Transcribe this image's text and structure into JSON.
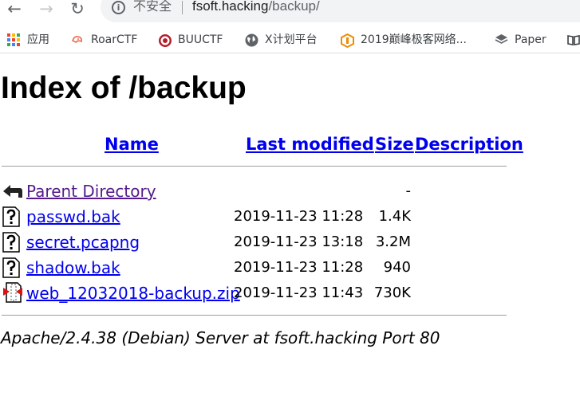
{
  "browser": {
    "security_label": "不安全",
    "url_host": "fsoft.hacking",
    "url_path": "/backup/"
  },
  "bookmarks": [
    {
      "label": "应用",
      "icon": "apps-grid-icon"
    },
    {
      "label": "RoarCTF",
      "icon": "roarctf-icon"
    },
    {
      "label": "BUUCTF",
      "icon": "buuctf-icon"
    },
    {
      "label": "X计划平台",
      "icon": "globe-icon"
    },
    {
      "label": "2019巅峰极客网络...",
      "icon": "hexagon-logo-icon"
    },
    {
      "label": "Paper",
      "icon": "layers-icon"
    }
  ],
  "page": {
    "title": "Index of /backup",
    "columns": {
      "name": "Name",
      "last_modified": "Last modified",
      "size": "Size",
      "description": "Description"
    },
    "rows": [
      {
        "name": "Parent Directory",
        "date": "",
        "size": "-",
        "icon": "back-arrow-icon"
      },
      {
        "name": "passwd.bak",
        "date": "2019-11-23 11:28",
        "size": "1.4K",
        "icon": "unknown-file-icon"
      },
      {
        "name": "secret.pcapng",
        "date": "2019-11-23 13:18",
        "size": "3.2M",
        "icon": "unknown-file-icon"
      },
      {
        "name": "shadow.bak",
        "date": "2019-11-23 11:28",
        "size": "940",
        "icon": "unknown-file-icon"
      },
      {
        "name": "web_12032018-backup.zip",
        "date": "2019-11-23 11:43",
        "size": "730K",
        "icon": "compressed-file-icon"
      }
    ],
    "footer": "Apache/2.4.38 (Debian) Server at fsoft.hacking Port 80"
  },
  "colors": {
    "link": "#0000ee",
    "visited_link": "#551a8b"
  }
}
